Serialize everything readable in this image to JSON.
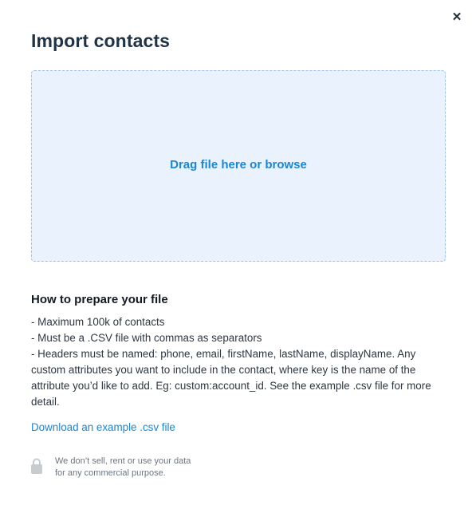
{
  "modal": {
    "title": "Import contacts",
    "close_icon": "close-icon",
    "close_glyph": "✕"
  },
  "dropzone": {
    "label": "Drag file here or browse",
    "background": "#eaf2fd",
    "border_color": "#9ec4ea",
    "accent": "#1a86d6"
  },
  "instructions": {
    "title": "How to prepare your file",
    "items": [
      "- Maximum 100k of contacts",
      "- Must be a .CSV file with commas as separators",
      "- Headers must be named: phone, email, firstName, lastName, displayName. Any custom attributes you want to include in the contact, where key is the name of the attribute you’d like to add. Eg: custom:account_id. See the example .csv file for more detail."
    ]
  },
  "download_link": {
    "label": "Download an example .csv file"
  },
  "privacy": {
    "icon": "lock-icon",
    "line1": "We don’t sell, rent or use your data",
    "line2": "for any commercial purpose."
  }
}
